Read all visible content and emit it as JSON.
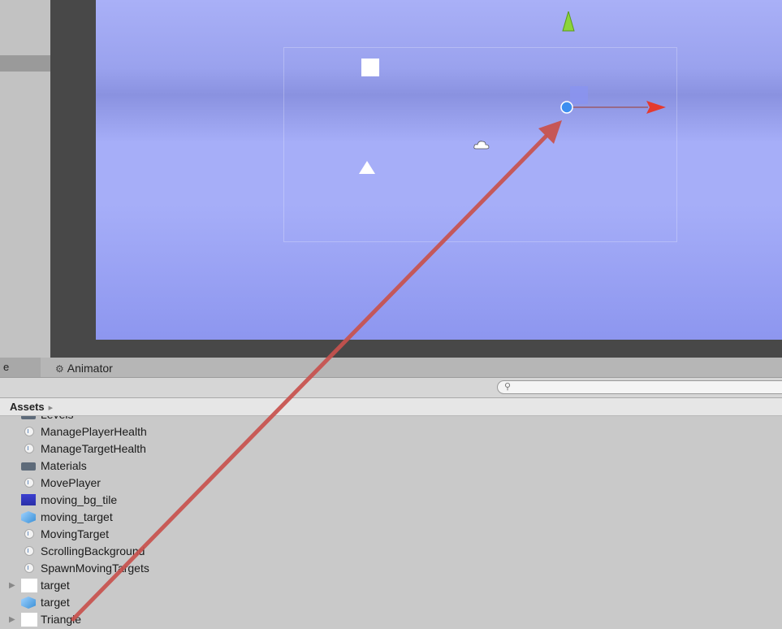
{
  "tabs": {
    "prev_fragment": "e",
    "animator": "Animator"
  },
  "search": {
    "placeholder": "",
    "value": ""
  },
  "breadcrumb": {
    "root": "Assets",
    "separator": "▸"
  },
  "assets": [
    {
      "name": "Levels",
      "type": "folder",
      "partial": true
    },
    {
      "name": "ManagePlayerHealth",
      "type": "script"
    },
    {
      "name": "ManageTargetHealth",
      "type": "script"
    },
    {
      "name": "Materials",
      "type": "folder"
    },
    {
      "name": "MovePlayer",
      "type": "script"
    },
    {
      "name": "moving_bg_tile",
      "type": "texture"
    },
    {
      "name": "moving_target",
      "type": "prefab"
    },
    {
      "name": "MovingTarget",
      "type": "script"
    },
    {
      "name": "ScrollingBackground",
      "type": "script"
    },
    {
      "name": "SpawnMovingTargets",
      "type": "script"
    },
    {
      "name": "target",
      "type": "sprite",
      "expandable": true
    },
    {
      "name": "target",
      "type": "prefab"
    },
    {
      "name": "Triangle",
      "type": "sprite",
      "expandable": true
    }
  ],
  "colors": {
    "scene_bg": "#a6aef8",
    "arrow": "#c8524e",
    "gizmo_x": "#e43a2f",
    "gizmo_y": "#8cd43a",
    "gizmo_center": "#3d8ef0"
  },
  "icons": {
    "search": "magnifier-icon",
    "animator": "animator-icon"
  }
}
